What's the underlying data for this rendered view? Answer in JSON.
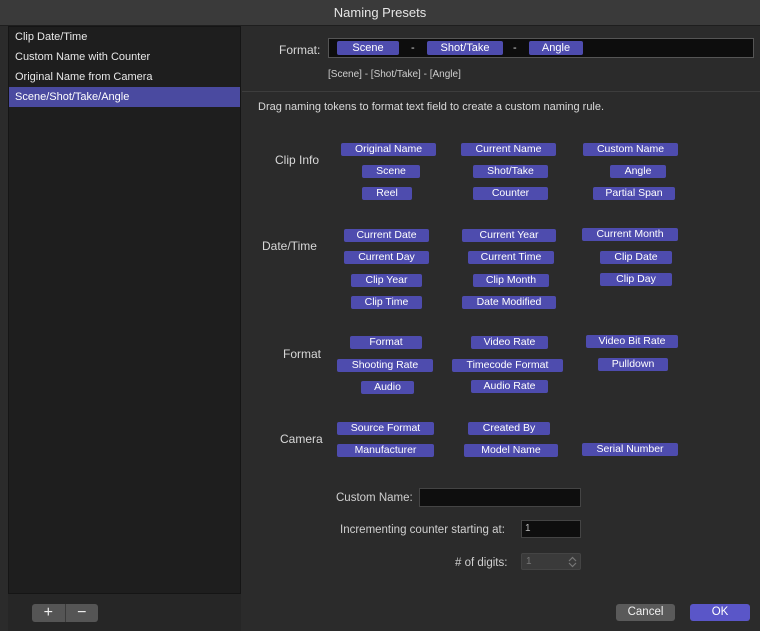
{
  "window": {
    "title": "Naming Presets"
  },
  "sidebar": {
    "items": [
      {
        "label": "Clip Date/Time",
        "selected": false
      },
      {
        "label": "Custom Name with Counter",
        "selected": false
      },
      {
        "label": "Original Name from Camera",
        "selected": false
      },
      {
        "label": "Scene/Shot/Take/Angle",
        "selected": true
      }
    ],
    "add_icon": "+",
    "remove_icon": "−"
  },
  "format": {
    "label": "Format:",
    "tokens": [
      "Scene",
      "Shot/Take",
      "Angle"
    ],
    "separator": "-",
    "preview": "[Scene] - [Shot/Take] - [Angle]"
  },
  "instructions": "Drag naming tokens to format text field to create a custom naming rule.",
  "groups": {
    "clip_info": {
      "label": "Clip Info",
      "tokens": [
        "Original Name",
        "Current Name",
        "Custom Name",
        "Scene",
        "Shot/Take",
        "Angle",
        "Reel",
        "Counter",
        "Partial Span"
      ]
    },
    "date_time": {
      "label": "Date/Time",
      "tokens": [
        "Current Date",
        "Current Year",
        "Current Month",
        "Current Day",
        "Current Time",
        "Clip Date",
        "Clip Year",
        "Clip Month",
        "Clip Day",
        "Clip Time",
        "Date Modified"
      ]
    },
    "format": {
      "label": "Format",
      "tokens": [
        "Format",
        "Video Rate",
        "Video Bit Rate",
        "Shooting Rate",
        "Timecode Format",
        "Pulldown",
        "Audio",
        "Audio Rate"
      ]
    },
    "camera": {
      "label": "Camera",
      "tokens": [
        "Source Format",
        "Created By",
        "Manufacturer",
        "Model Name",
        "Serial Number"
      ]
    }
  },
  "custom_name": {
    "label": "Custom Name:",
    "value": ""
  },
  "counter": {
    "label": "Incrementing counter starting at:",
    "value": "1"
  },
  "digits": {
    "label": "# of digits:",
    "value": "1"
  },
  "buttons": {
    "cancel": "Cancel",
    "ok": "OK"
  }
}
